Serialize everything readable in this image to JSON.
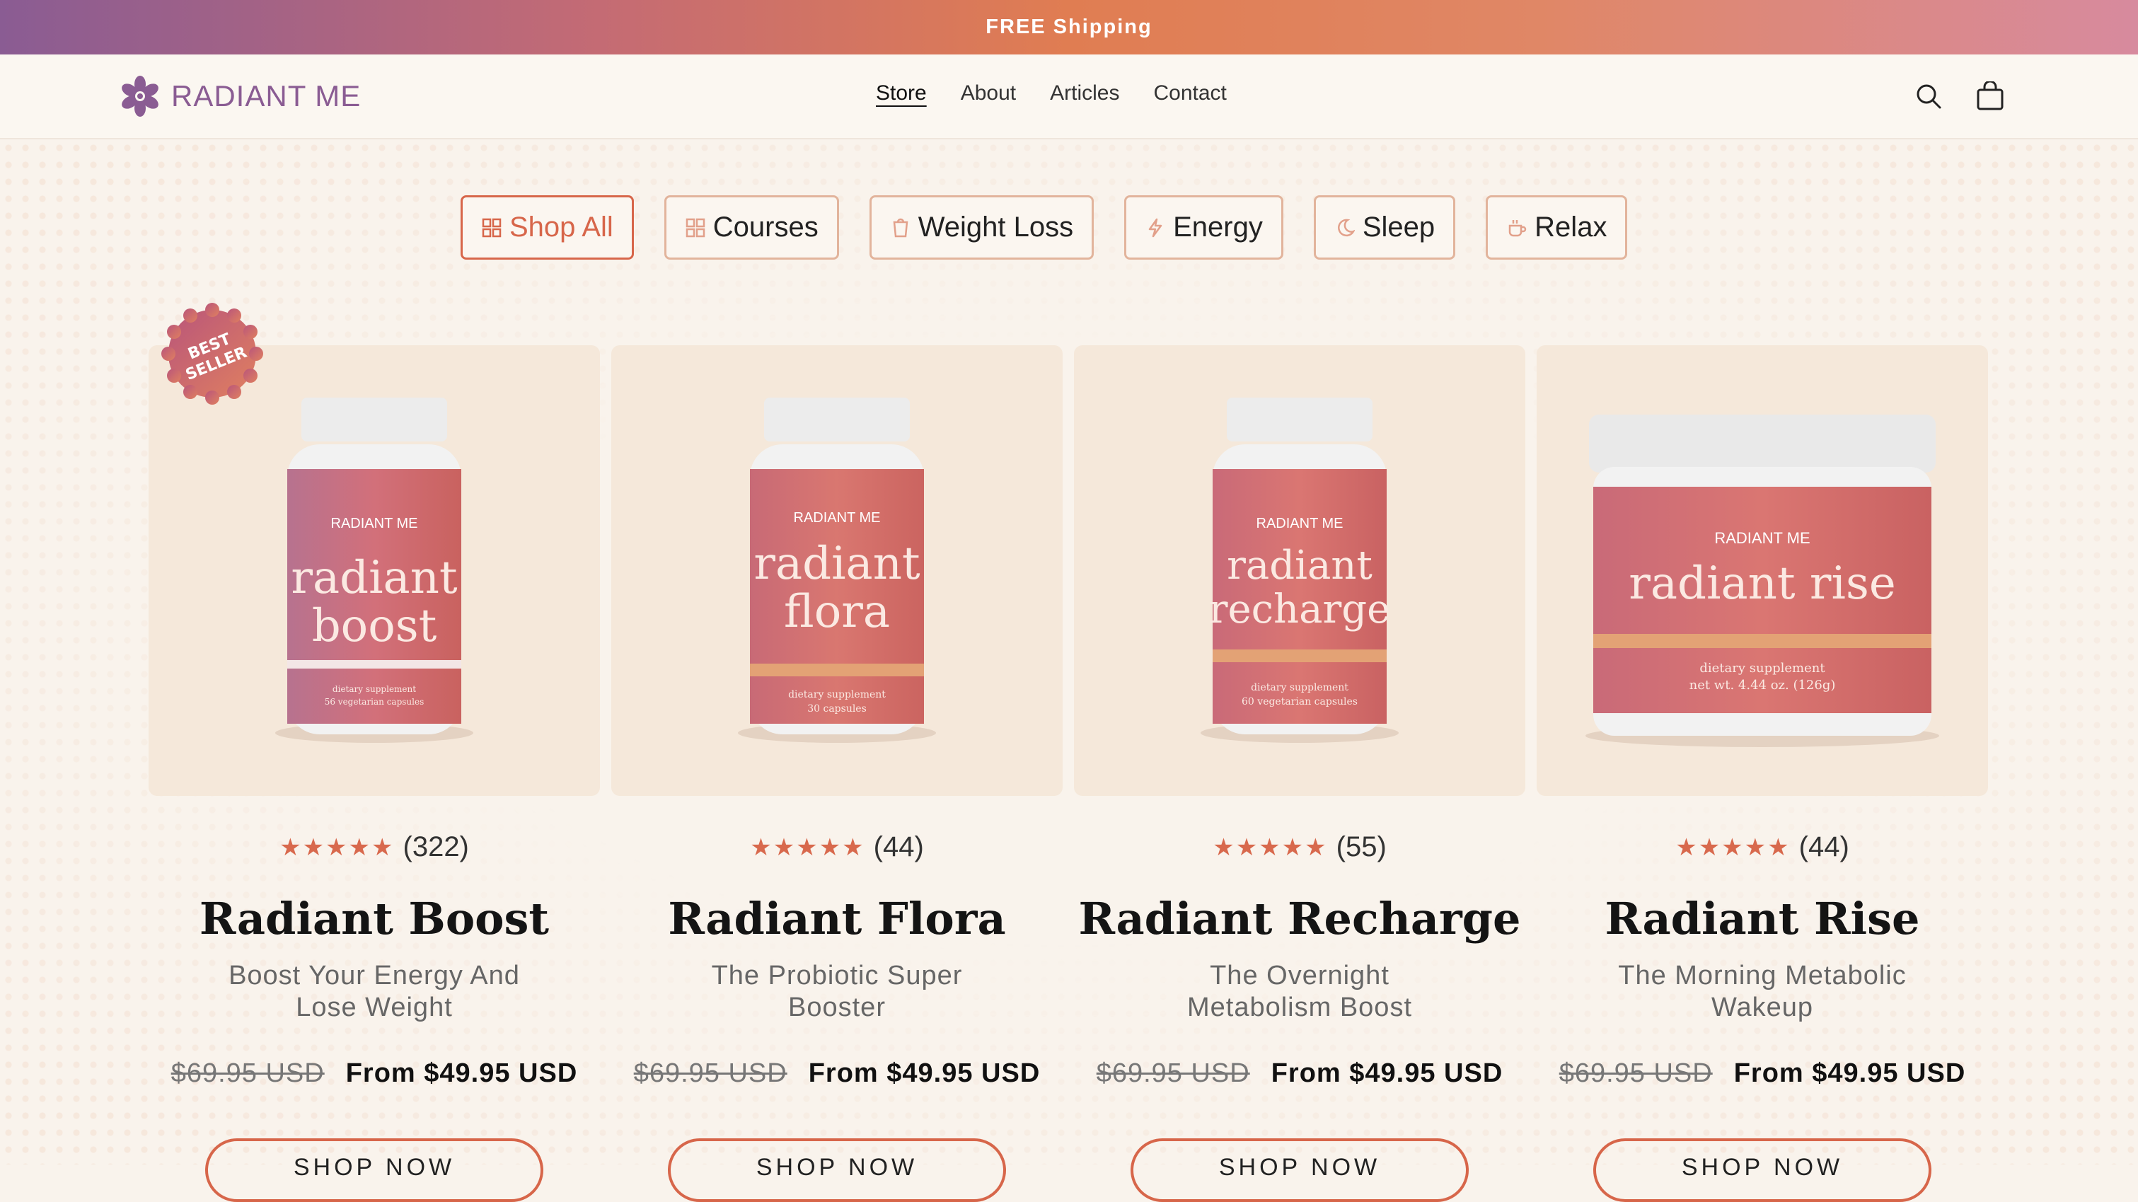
{
  "announcement": "FREE Shipping",
  "brand": {
    "name": "RADIANT ME",
    "color": "#8a5c93"
  },
  "nav": [
    "Store",
    "About",
    "Articles",
    "Contact"
  ],
  "header_icons": [
    "search-icon",
    "cart-icon"
  ],
  "filters": [
    {
      "label": "Shop All",
      "icon": "grid-icon",
      "active": true
    },
    {
      "label": "Courses",
      "icon": "grid-icon",
      "active": false
    },
    {
      "label": "Weight Loss",
      "icon": "scale-icon",
      "active": false
    },
    {
      "label": "Energy",
      "icon": "bolt-icon",
      "active": false
    },
    {
      "label": "Sleep",
      "icon": "moon-icon",
      "active": false
    },
    {
      "label": "Relax",
      "icon": "cup-icon",
      "active": false
    }
  ],
  "badge": [
    "BEST",
    "SELLER"
  ],
  "products": [
    {
      "name": "Radiant Boost",
      "subtitle": [
        "Boost Your Energy And",
        "Lose Weight"
      ],
      "rating_count": "(322)",
      "stars": "★★★★★",
      "old_price": "$69.95 USD",
      "price": "From $49.95 USD",
      "button": "SHOP NOW",
      "label_brand": "RADIANT ME",
      "label_line1": "radiant",
      "label_line2": "boost",
      "label_small1": "dietary supplement",
      "label_small2": "56 vegetarian capsules"
    },
    {
      "name": "Radiant Flora",
      "subtitle": [
        "The Probiotic Super",
        "Booster"
      ],
      "rating_count": "(44)",
      "stars": "★★★★★",
      "old_price": "$69.95 USD",
      "price": "From $49.95 USD",
      "button": "SHOP NOW",
      "label_brand": "RADIANT ME",
      "label_line1": "radiant",
      "label_line2": "flora",
      "label_small1": "dietary supplement",
      "label_small2": "30 capsules"
    },
    {
      "name": "Radiant Recharge",
      "subtitle": [
        "The Overnight",
        "Metabolism Boost"
      ],
      "rating_count": "(55)",
      "stars": "★★★★★",
      "old_price": "$69.95 USD",
      "price": "From $49.95 USD",
      "button": "SHOP NOW",
      "label_brand": "RADIANT ME",
      "label_line1": "radiant",
      "label_line2": "recharge",
      "label_small1": "dietary supplement",
      "label_small2": "60 vegetarian capsules"
    },
    {
      "name": "Radiant Rise",
      "subtitle": [
        "The Morning Metabolic",
        "Wakeup"
      ],
      "rating_count": "(44)",
      "stars": "★★★★★",
      "old_price": "$69.95 USD",
      "price": "From $49.95 USD",
      "button": "SHOP NOW",
      "label_brand": "RADIANT ME",
      "label_line1": "radiant rise",
      "label_line2": "",
      "label_small1": "dietary supplement",
      "label_small2": "net wt. 4.44 oz. (126g)"
    }
  ],
  "colors": {
    "accent": "#d7664a",
    "card_bg": "#f5e8da",
    "page_bg": "#f9f3ec"
  }
}
